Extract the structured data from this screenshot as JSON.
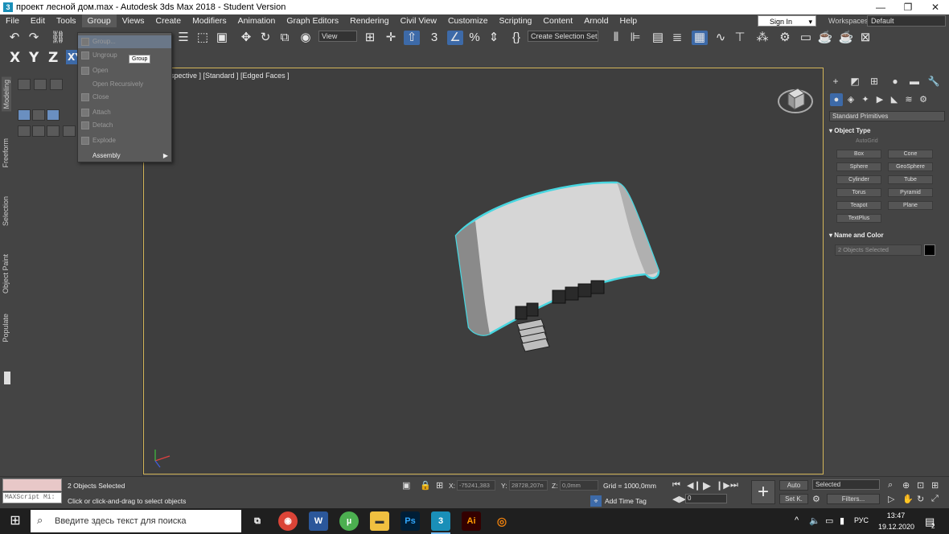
{
  "window": {
    "title": "проект лесной дом.max - Autodesk 3ds Max 2018 - Student Version",
    "controls": [
      "—",
      "❐",
      "✕"
    ]
  },
  "menu": {
    "items": [
      "File",
      "Edit",
      "Tools",
      "Group",
      "Views",
      "Create",
      "Modifiers",
      "Animation",
      "Graph Editors",
      "Rendering",
      "Civil View",
      "Customize",
      "Scripting",
      "Content",
      "Arnold",
      "Help"
    ],
    "signin": "Sign In",
    "workspaces_label": "Workspaces:",
    "workspaces_value": "Default"
  },
  "toolbar": {
    "view_dropdown": "View",
    "selection_set": "Create Selection Set"
  },
  "axes": {
    "x": "X",
    "y": "Y",
    "z": "Z",
    "xy": "XY"
  },
  "group_menu": {
    "items": [
      {
        "label": "Group...",
        "enabled": false,
        "highlighted": true
      },
      {
        "label": "Ungroup",
        "enabled": false
      },
      {
        "label": "Open",
        "enabled": false
      },
      {
        "label": "Open Recursively",
        "enabled": false
      },
      {
        "label": "Close",
        "enabled": false
      },
      {
        "label": "Attach",
        "enabled": false
      },
      {
        "label": "Detach",
        "enabled": false
      },
      {
        "label": "Explode",
        "enabled": false
      },
      {
        "label": "Assembly",
        "enabled": true
      }
    ],
    "tooltip": "Group"
  },
  "left_tabs": [
    "Modeling",
    "Freeform",
    "Selection",
    "Object Paint",
    "Populate"
  ],
  "viewport": {
    "label": "spective ] [Standard ] [Edged Faces ]",
    "border_color": "#d4b65a",
    "selection_color": "#48d6e0"
  },
  "right_panel": {
    "category_dropdown": "Standard Primitives",
    "object_type_title": "Object Type",
    "autogrid": "AutoGrid",
    "primitives": [
      "Box",
      "Cone",
      "Sphere",
      "GeoSphere",
      "Cylinder",
      "Tube",
      "Torus",
      "Pyramid",
      "Teapot",
      "Plane",
      "TextPlus"
    ],
    "name_color_title": "Name and Color",
    "name_field": "2 Objects Selected"
  },
  "status": {
    "maxscript": "MAXScript Mi:",
    "objects_selected": "2 Objects Selected",
    "prompt": "Click or click-and-drag to select objects",
    "x_label": "X:",
    "x_value": "-75241,383",
    "y_label": "Y:",
    "y_value": "28728,207n",
    "z_label": "Z:",
    "z_value": "0,0mm",
    "grid": "Grid = 1000,0mm",
    "add_time_tag": "Add Time Tag",
    "auto": "Auto",
    "set_key": "Set K.",
    "selected": "Selected",
    "filters": "Filters...",
    "frame": "0"
  },
  "taskbar": {
    "search_placeholder": "Введите здесь текст для поиска",
    "lang": "РУС",
    "time": "13:47",
    "date": "19.12.2020",
    "notification_count": "2"
  }
}
